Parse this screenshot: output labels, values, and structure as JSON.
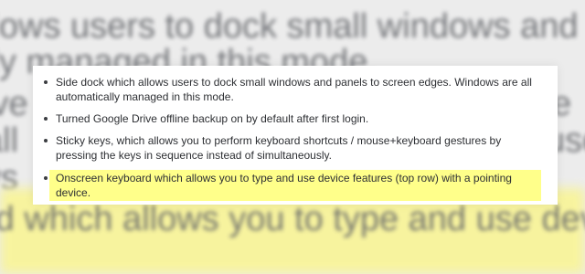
{
  "background": {
    "lines": [
      "llows users to dock small windows and panels to scr",
      "lly managed in this mode.",
      "ive",
      " all",
      "ys",
      "rd which allows you to type and use device features"
    ],
    "right_fragments": [
      "use",
      "e"
    ],
    "highlight_color": "#f8f49a"
  },
  "list": {
    "items": [
      {
        "text": "Side dock which allows users to dock small windows and panels to screen edges. Windows are all automatically managed in this mode.",
        "highlighted": false
      },
      {
        "text": "Turned Google Drive offline backup on by default after first login.",
        "highlighted": false
      },
      {
        "text": "Sticky keys, which allows you to perform keyboard shortcuts / mouse+keyboard gestures by pressing the keys in sequence instead of simultaneously.",
        "highlighted": false
      },
      {
        "text": "Onscreen keyboard which allows you to type and use device features (top row) with a pointing device.",
        "highlighted": true
      }
    ],
    "highlight_color": "#ffff8a",
    "text_color": "#2d2f33"
  }
}
